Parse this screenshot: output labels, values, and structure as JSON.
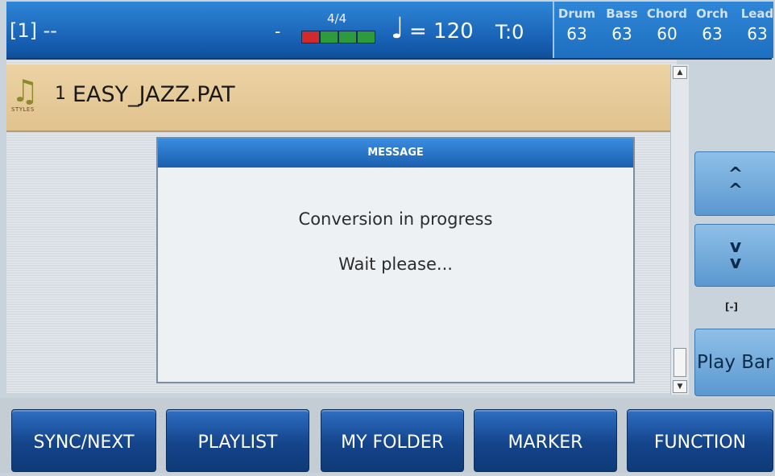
{
  "status_bar": {
    "song": "[1] --",
    "dot": "-",
    "meter": "4/4",
    "note_glyph": "♩",
    "tempo": "= 120",
    "transpose": "T:0",
    "volumes": [
      {
        "name": "Drum",
        "value": "63"
      },
      {
        "name": "Bass",
        "value": "63"
      },
      {
        "name": "Chord",
        "value": "60"
      },
      {
        "name": "Orch",
        "value": "63"
      },
      {
        "name": "Lead",
        "value": "63"
      }
    ]
  },
  "style_row": {
    "icon_caption": "STYLES",
    "number": "1",
    "name": "EASY_JAZZ.PAT"
  },
  "dialog": {
    "title": "MESSAGE",
    "line1": "Conversion in progress",
    "line2": "Wait please..."
  },
  "side_panel": {
    "up_label": "^\n^",
    "down_label": "v\nv",
    "indicator": "[-]",
    "play_bar_label": "Play Bar"
  },
  "bottom_buttons": [
    {
      "label": "SYNC/NEXT"
    },
    {
      "label": "PLAYLIST"
    },
    {
      "label": "MY FOLDER"
    },
    {
      "label": "MARKER"
    },
    {
      "label": "FUNCTION"
    }
  ]
}
